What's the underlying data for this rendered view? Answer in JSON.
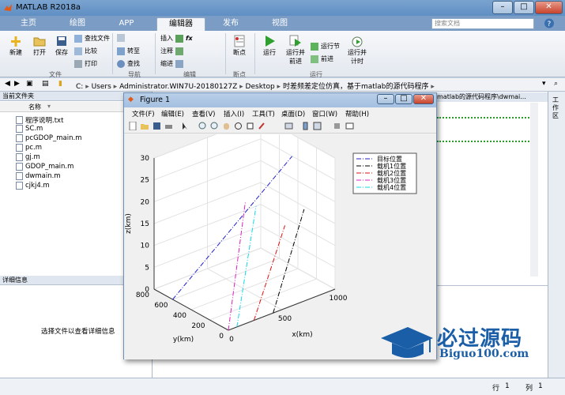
{
  "window": {
    "title": "MATLAB R2018a"
  },
  "tabs": [
    "主页",
    "绘图",
    "APP",
    "编辑器",
    "发布",
    "视图"
  ],
  "active_tab": "编辑器",
  "search": {
    "placeholder": "搜索文档"
  },
  "ribbon": {
    "file": {
      "new": "新建",
      "open": "打开",
      "save": "保存",
      "find_files": "查找文件",
      "compare": "比较",
      "print": "打印",
      "group": "文件"
    },
    "navigate": {
      "goto": "转至",
      "find": "查找",
      "group": "导航"
    },
    "edit": {
      "insert": "插入",
      "comment": "注释",
      "indent": "缩进",
      "group": "编辑"
    },
    "breakpoints": {
      "label": "断点",
      "group": "断点"
    },
    "run": {
      "run": "运行",
      "run_advance": "运行并\n前进",
      "run_section": "运行节",
      "advance": "前进",
      "run_time": "运行并\n计时",
      "group": "运行"
    }
  },
  "address": {
    "path_parts": [
      "C:",
      "Users",
      "Administrator.WIN7U-20180127Z",
      "Desktop",
      "时差频差定位仿真，基于matlab的源代码程序"
    ]
  },
  "current_folder": {
    "title": "当前文件夹",
    "column": "名称",
    "files": [
      "程序说明.txt",
      "SC.m",
      "pcGDOP_main.m",
      "pc.m",
      "gj.m",
      "GDOP_main.m",
      "dwmain.m",
      "cjkj4.m"
    ]
  },
  "details": {
    "title": "详细信息",
    "hint": "选择文件以查看详细信息"
  },
  "editor": {
    "tab_title": "matlab的源代码程序\\dwmai..."
  },
  "workspace_strip": {
    "label": "工作区"
  },
  "status": {
    "row_label": "行",
    "row": "1",
    "col_label": "列",
    "col": "1"
  },
  "figure": {
    "title": "Figure 1",
    "menu": [
      "文件(F)",
      "编辑(E)",
      "查看(V)",
      "插入(I)",
      "工具(T)",
      "桌面(D)",
      "窗口(W)",
      "帮助(H)"
    ]
  },
  "chart_data": {
    "type": "line",
    "dimensions": 3,
    "xlabel": "x(km)",
    "ylabel": "y(km)",
    "zlabel": "z(km)",
    "xlim": [
      0,
      1000
    ],
    "ylim": [
      0,
      800
    ],
    "zlim": [
      0,
      30
    ],
    "xticks": [
      0,
      500,
      1000
    ],
    "yticks": [
      0,
      200,
      400,
      600,
      800
    ],
    "zticks": [
      0,
      5,
      10,
      15,
      20,
      25,
      30
    ],
    "grid": true,
    "legend_position": "top-right",
    "series": [
      {
        "name": "目标位置",
        "color": "#1f1fd0",
        "style": "dashdot",
        "points": [
          [
            0,
            600,
            0
          ],
          [
            780,
            210,
            30
          ]
        ]
      },
      {
        "name": "载机1位置",
        "color": "#000000",
        "style": "dashdot",
        "points": [
          [
            420,
            0,
            0
          ],
          [
            710,
            0,
            21
          ]
        ]
      },
      {
        "name": "载机2位置",
        "color": "#e01010",
        "style": "dashdot",
        "points": [
          [
            240,
            0,
            0
          ],
          [
            530,
            0,
            19
          ]
        ]
      },
      {
        "name": "载机3位置",
        "color": "#e020c0",
        "style": "dashdot",
        "points": [
          [
            0,
            0,
            0
          ],
          [
            160,
            0,
            28
          ]
        ]
      },
      {
        "name": "载机4位置",
        "color": "#10d8e8",
        "style": "dashdot",
        "points": [
          [
            80,
            0,
            0
          ],
          [
            260,
            0,
            26
          ]
        ]
      }
    ]
  },
  "watermark": {
    "title": "必过源码",
    "url": "Biguo100.com"
  }
}
